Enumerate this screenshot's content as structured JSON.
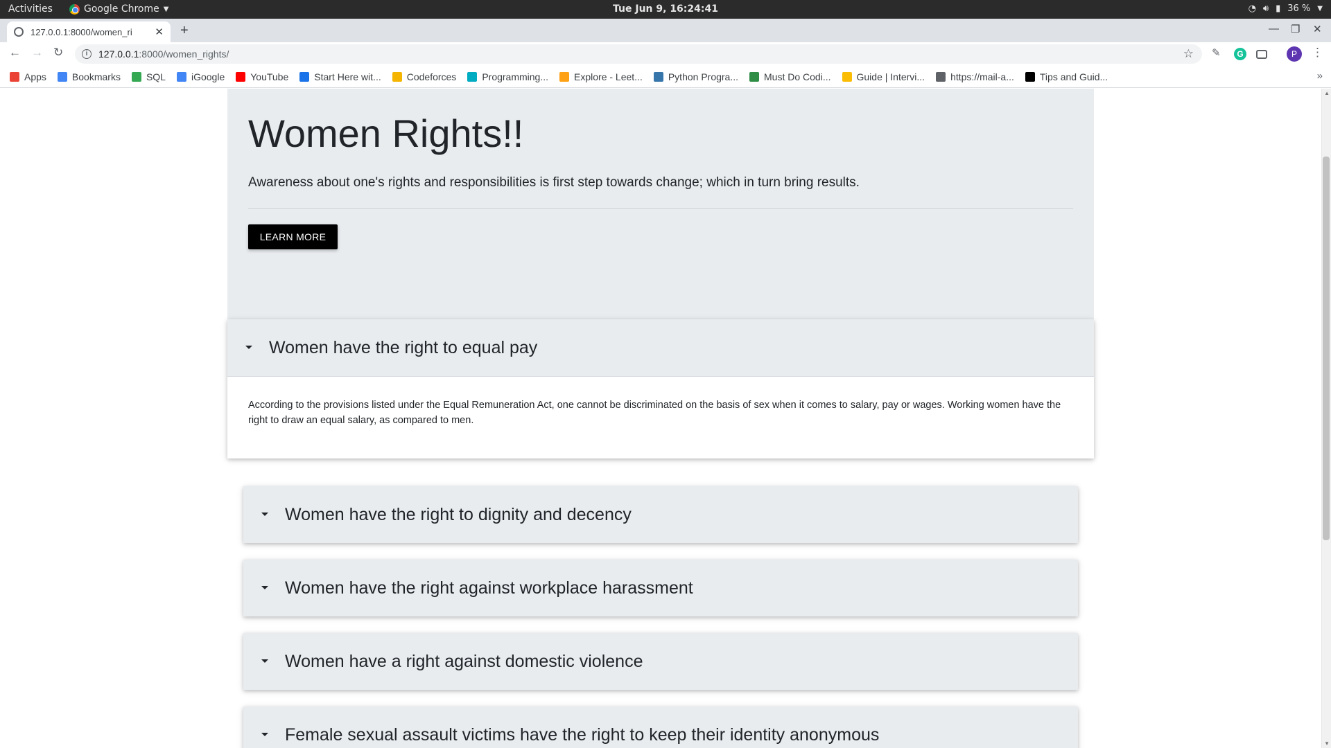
{
  "os_bar": {
    "activities": "Activities",
    "app_name": "Google Chrome",
    "clock": "Tue Jun  9, 16:24:41",
    "battery": "36 %"
  },
  "browser": {
    "tab_title": "127.0.0.1:8000/women_ri",
    "url_host": "127.0.0.1",
    "url_path": ":8000/women_rights/",
    "profile_initial": "P",
    "bookmarks": [
      {
        "label": "Apps",
        "icon": "apps-grid-icon",
        "color": "#ea4335"
      },
      {
        "label": "Bookmarks",
        "icon": "star-icon",
        "color": "#4285f4"
      },
      {
        "label": "SQL",
        "icon": "sql-icon",
        "color": "#34a853"
      },
      {
        "label": "iGoogle",
        "icon": "google-icon",
        "color": "#4285f4"
      },
      {
        "label": "YouTube",
        "icon": "youtube-icon",
        "color": "#ff0000"
      },
      {
        "label": "Start Here wit...",
        "icon": "circle-p-icon",
        "color": "#1a73e8"
      },
      {
        "label": "Codeforces",
        "icon": "bar-chart-icon",
        "color": "#f4b400"
      },
      {
        "label": "Programming...",
        "icon": "beta-icon",
        "color": "#00acc1"
      },
      {
        "label": "Explore - Leet...",
        "icon": "leetcode-icon",
        "color": "#ffa116"
      },
      {
        "label": "Python Progra...",
        "icon": "python-icon",
        "color": "#3776ab"
      },
      {
        "label": "Must Do Codi...",
        "icon": "gfg-icon",
        "color": "#2f8d46"
      },
      {
        "label": "Guide | Intervi...",
        "icon": "folder-icon",
        "color": "#fbbc04"
      },
      {
        "label": "https://mail-a...",
        "icon": "globe-icon",
        "color": "#5f6368"
      },
      {
        "label": "Tips and Guid...",
        "icon": "hackerrank-icon",
        "color": "#000000"
      }
    ]
  },
  "page": {
    "hero_title": "Women Rights!!",
    "hero_lead": "Awareness about one's rights and responsibilities is first step towards change; which in turn bring results.",
    "learn_more": "LEARN MORE",
    "accordion": [
      {
        "title": "Women have the right to equal pay",
        "body": "According to the provisions listed under the Equal Remuneration Act, one cannot be discriminated on the basis of sex when it comes to salary, pay or wages. Working women have the right to draw an equal salary, as compared to men."
      },
      {
        "title": "Women have the right to dignity and decency"
      },
      {
        "title": "Women have the right against workplace harassment"
      },
      {
        "title": "Women have a right against domestic violence"
      },
      {
        "title": "Female sexual assault victims have the right to keep their identity anonymous"
      }
    ]
  }
}
